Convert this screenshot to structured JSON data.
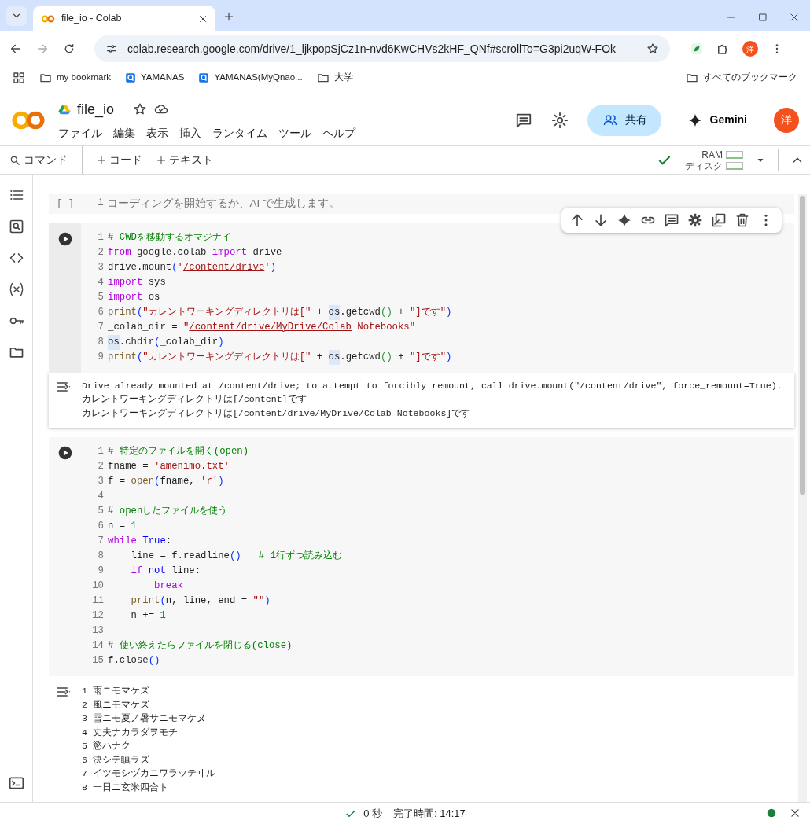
{
  "browser": {
    "tab_title": "file_io - Colab",
    "url": "colab.research.google.com/drive/1_ljkpopSjCz1n-nvd6KwCHVs2kHF_QNf#scrollTo=G3pi2uqW-FOk",
    "profile": "洋",
    "bookmarks": [
      {
        "kind": "folder",
        "label": "my bookmark"
      },
      {
        "kind": "site",
        "label": "YAMANAS"
      },
      {
        "kind": "site",
        "label": "YAMANAS(MyQnao..."
      },
      {
        "kind": "folder",
        "label": "大学"
      }
    ],
    "all_bookmarks": "すべてのブックマーク"
  },
  "notebook": {
    "title": "file_io",
    "menu": [
      "ファイル",
      "編集",
      "表示",
      "挿入",
      "ランタイム",
      "ツール",
      "ヘルプ"
    ],
    "share": "共有",
    "gemini": "Gemini",
    "avatar": "洋"
  },
  "toolbar": {
    "command": "コマンド",
    "add_code": "コード",
    "add_text": "テキスト",
    "ram": "RAM",
    "disk": "ディスク"
  },
  "cells": [
    {
      "kind": "empty",
      "focused": false,
      "bracket": "[ ]",
      "line_number": "1",
      "hint_before": "コーディングを開始するか、AI で",
      "hint_link": "生成",
      "hint_after": "します。"
    },
    {
      "kind": "code",
      "focused": true,
      "lines": [
        {
          "n": "1",
          "tokens": [
            {
              "kind": "cmt",
              "text": "# CWDを移動するオマジナイ"
            }
          ]
        },
        {
          "n": "2",
          "tokens": [
            {
              "kind": "kw",
              "text": "from"
            },
            {
              "kind": "p",
              "text": " google.colab "
            },
            {
              "kind": "kw",
              "text": "import"
            },
            {
              "kind": "p",
              "text": " drive"
            }
          ]
        },
        {
          "n": "3",
          "tokens": [
            {
              "kind": "p",
              "text": "drive.mount"
            },
            {
              "kind": "br",
              "text": "("
            },
            {
              "kind": "str",
              "text": "'"
            },
            {
              "kind": "ustr",
              "text": "/content/drive"
            },
            {
              "kind": "str",
              "text": "'"
            },
            {
              "kind": "br",
              "text": ")"
            }
          ]
        },
        {
          "n": "4",
          "tokens": [
            {
              "kind": "kw",
              "text": "import"
            },
            {
              "kind": "p",
              "text": " sys"
            }
          ]
        },
        {
          "n": "5",
          "tokens": [
            {
              "kind": "kw",
              "text": "import"
            },
            {
              "kind": "p",
              "text": " os"
            }
          ]
        },
        {
          "n": "6",
          "tokens": [
            {
              "kind": "fn",
              "text": "print"
            },
            {
              "kind": "br",
              "text": "("
            },
            {
              "kind": "str",
              "text": "\"カレントワーキングディレクトリは[\""
            },
            {
              "kind": "p",
              "text": " + "
            },
            {
              "kind": "hl",
              "text": "os"
            },
            {
              "kind": "p",
              "text": ".getcwd"
            },
            {
              "kind": "br2",
              "text": "()"
            },
            {
              "kind": "p",
              "text": " + "
            },
            {
              "kind": "str",
              "text": "\"]です\""
            },
            {
              "kind": "br",
              "text": ")"
            }
          ]
        },
        {
          "n": "7",
          "tokens": [
            {
              "kind": "p",
              "text": "_colab_dir = "
            },
            {
              "kind": "str",
              "text": "\""
            },
            {
              "kind": "ustr",
              "text": "/content/drive/MyDrive/Colab"
            },
            {
              "kind": "str",
              "text": " Notebooks\""
            }
          ]
        },
        {
          "n": "8",
          "tokens": [
            {
              "kind": "hl",
              "text": "os"
            },
            {
              "kind": "p",
              "text": ".chdir"
            },
            {
              "kind": "br",
              "text": "("
            },
            {
              "kind": "p",
              "text": "_colab_dir"
            },
            {
              "kind": "br",
              "text": ")"
            }
          ]
        },
        {
          "n": "9",
          "tokens": [
            {
              "kind": "fn",
              "text": "print"
            },
            {
              "kind": "br",
              "text": "("
            },
            {
              "kind": "str",
              "text": "\"カレントワーキングディレクトリは[\""
            },
            {
              "kind": "p",
              "text": " + "
            },
            {
              "kind": "hl",
              "text": "os"
            },
            {
              "kind": "p",
              "text": ".getcwd"
            },
            {
              "kind": "br2",
              "text": "()"
            },
            {
              "kind": "p",
              "text": " + "
            },
            {
              "kind": "str",
              "text": "\"]です\""
            },
            {
              "kind": "br",
              "text": ")"
            }
          ]
        }
      ],
      "output": [
        "Drive already mounted at /content/drive; to attempt to forcibly remount, call drive.mount(\"/content/drive\", force_remount=True).",
        "カレントワーキングディレクトリは[/content]です",
        "カレントワーキングディレクトリは[/content/drive/MyDrive/Colab Notebooks]です"
      ]
    },
    {
      "kind": "code",
      "focused": false,
      "lines": [
        {
          "n": "1",
          "tokens": [
            {
              "kind": "cmt",
              "text": "# 特定のファイルを開く(open)"
            }
          ]
        },
        {
          "n": "2",
          "tokens": [
            {
              "kind": "p",
              "text": "fname = "
            },
            {
              "kind": "str",
              "text": "'amenimo.txt'"
            }
          ]
        },
        {
          "n": "3",
          "tokens": [
            {
              "kind": "p",
              "text": "f = "
            },
            {
              "kind": "fn",
              "text": "open"
            },
            {
              "kind": "br",
              "text": "("
            },
            {
              "kind": "p",
              "text": "fname, "
            },
            {
              "kind": "str",
              "text": "'r'"
            },
            {
              "kind": "br",
              "text": ")"
            }
          ]
        },
        {
          "n": "4"
        },
        {
          "n": "5",
          "tokens": [
            {
              "kind": "cmt",
              "text": "# openしたファイルを使う"
            }
          ]
        },
        {
          "n": "6",
          "tokens": [
            {
              "kind": "p",
              "text": "n = "
            },
            {
              "kind": "num",
              "text": "1"
            }
          ]
        },
        {
          "n": "7",
          "tokens": [
            {
              "kind": "kw",
              "text": "while"
            },
            {
              "kind": "bool",
              "text": " True"
            },
            {
              "kind": "p",
              "text": ":"
            }
          ]
        },
        {
          "n": "8",
          "tokens": [
            {
              "kind": "p",
              "text": "    line = f.readline"
            },
            {
              "kind": "br",
              "text": "()"
            },
            {
              "kind": "cmt",
              "text": "   # 1行ずつ読み込む"
            }
          ]
        },
        {
          "n": "9",
          "tokens": [
            {
              "kind": "kw",
              "text": "    if"
            },
            {
              "kind": "bool",
              "text": " not"
            },
            {
              "kind": "p",
              "text": " line:"
            }
          ]
        },
        {
          "n": "10",
          "tokens": [
            {
              "kind": "kw",
              "text": "        break"
            }
          ]
        },
        {
          "n": "11",
          "tokens": [
            {
              "kind": "fn",
              "text": "    print"
            },
            {
              "kind": "br",
              "text": "("
            },
            {
              "kind": "p",
              "text": "n, line, end = "
            },
            {
              "kind": "str",
              "text": "\"\""
            },
            {
              "kind": "br",
              "text": ")"
            }
          ]
        },
        {
          "n": "12",
          "tokens": [
            {
              "kind": "p",
              "text": "    n += "
            },
            {
              "kind": "num",
              "text": "1"
            }
          ]
        },
        {
          "n": "13"
        },
        {
          "n": "14",
          "tokens": [
            {
              "kind": "cmt",
              "text": "# 使い終えたらファイルを閉じる(close)"
            }
          ]
        },
        {
          "n": "15",
          "tokens": [
            {
              "kind": "p",
              "text": "f.close"
            },
            {
              "kind": "br",
              "text": "()"
            }
          ]
        }
      ],
      "output": [
        "1 雨ニモマケズ",
        "2 風ニモマケズ",
        "3 雪ニモ夏ノ暑サニモマケヌ",
        "4 丈夫ナカラダヲモチ",
        "5 慾ハナク",
        "6 決シテ瞋ラズ",
        "7 イツモシヅカニワラッテヰル",
        "8 一日ニ玄米四合ト"
      ]
    }
  ],
  "status_bar": {
    "elapsed": "0 秒",
    "completed": "完了時間: 14:17"
  }
}
